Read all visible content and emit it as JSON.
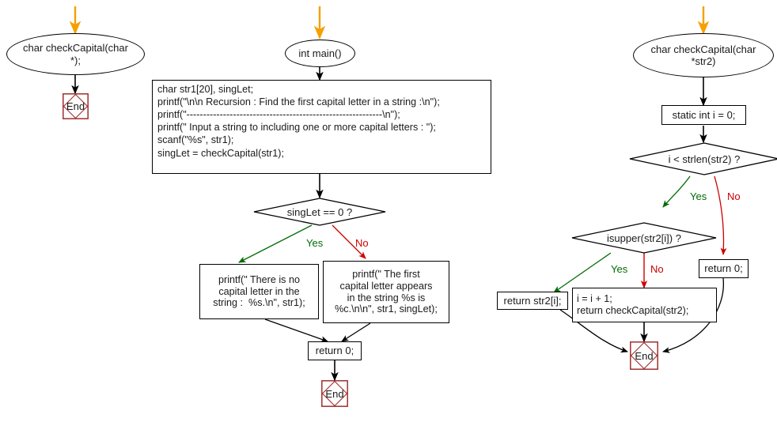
{
  "diagram": {
    "title": "C Recursion flowchart: find the first capital letter in a string",
    "colors": {
      "line": "#000000",
      "yes": "#006b00",
      "no": "#cc0000",
      "start_arrow": "#f5a000",
      "terminator_border": "#a03030",
      "background": "#ffffff",
      "text": "#1a1a1a"
    }
  },
  "left_column": {
    "prototype_oval": "char checkCapital(char\n*);",
    "end_terminator": "End"
  },
  "main_column": {
    "start_oval": "int main()",
    "code_block": "char str1[20], singLet;\nprintf(\"\\n\\n Recursion : Find the first capital letter in a string :\\n\");\nprintf(\"-----------------------------------------------------------\\n\");\nprintf(\" Input a string to including one or more capital letters : \");\nscanf(\"%s\", str1);\nsingLet = checkCapital(str1);",
    "decision": "singLet == 0 ?",
    "yes_label": "Yes",
    "no_label": "No",
    "yes_branch_box": "printf(\" There is no\ncapital letter in the\nstring :  %s.\\n\", str1);",
    "no_branch_box": "printf(\" The first\ncapital letter appears\nin the string %s is\n%c.\\n\\n\", str1, singLet);",
    "return_box": "return 0;",
    "end_terminator": "End"
  },
  "function_column": {
    "header_oval": "char checkCapital(char\n*str2)",
    "static_box": "static int i = 0;",
    "decision_loop": "i < strlen(str2) ?",
    "loop_yes_label": "Yes",
    "loop_no_label": "No",
    "decision_isupper": "isupper(str2[i]) ?",
    "isupper_yes_label": "Yes",
    "isupper_no_label": "No",
    "return_zero_box": "return 0;",
    "return_char_box": "return str2[i];",
    "increment_box": "i = i + 1;\nreturn checkCapital(str2);",
    "end_terminator": "End"
  }
}
